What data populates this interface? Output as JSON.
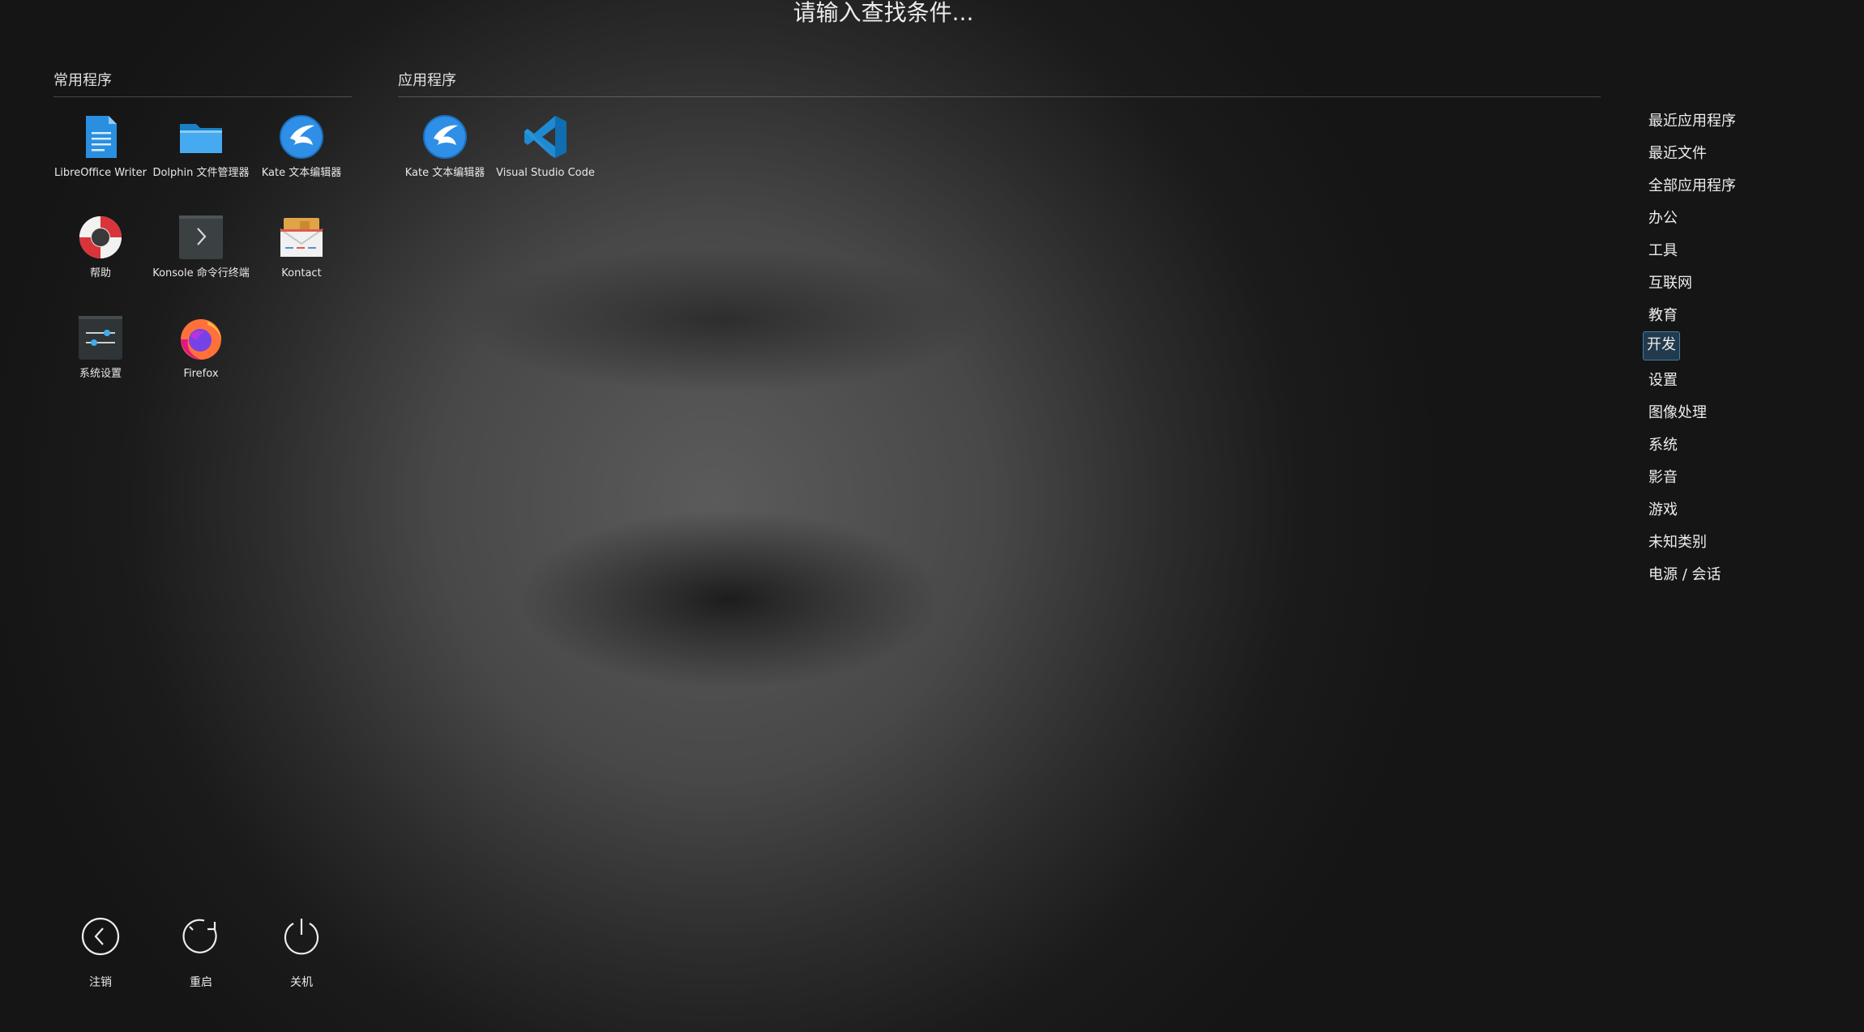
{
  "search": {
    "placeholder": "请输入查找条件..."
  },
  "favorites": {
    "title": "常用程序",
    "items": [
      {
        "label": "LibreOffice Writer",
        "icon": "libreoffice-writer-icon"
      },
      {
        "label": "Dolphin 文件管理器",
        "icon": "dolphin-folder-icon"
      },
      {
        "label": "Kate 文本编辑器",
        "icon": "kate-icon"
      },
      {
        "label": "帮助",
        "icon": "help-lifebuoy-icon"
      },
      {
        "label": "Konsole 命令行终端",
        "icon": "konsole-terminal-icon"
      },
      {
        "label": "Kontact",
        "icon": "kontact-mail-icon"
      },
      {
        "label": "系统设置",
        "icon": "system-settings-icon"
      },
      {
        "label": "Firefox",
        "icon": "firefox-icon"
      }
    ]
  },
  "applications": {
    "title": "应用程序",
    "items": [
      {
        "label": "Kate 文本编辑器",
        "icon": "kate-icon"
      },
      {
        "label": "Visual Studio Code",
        "icon": "vscode-icon"
      }
    ]
  },
  "categories": {
    "selected": "开发",
    "items": [
      "最近应用程序",
      "最近文件",
      "全部应用程序",
      "办公",
      "工具",
      "互联网",
      "教育",
      "开发",
      "设置",
      "图像处理",
      "系统",
      "影音",
      "游戏",
      "未知类别",
      "电源 / 会话"
    ]
  },
  "power": {
    "items": [
      {
        "label": "注销",
        "icon": "logout-icon"
      },
      {
        "label": "重启",
        "icon": "restart-icon"
      },
      {
        "label": "关机",
        "icon": "shutdown-icon"
      }
    ]
  },
  "colors": {
    "accent": "#3d7fae",
    "text": "#e6e6e6"
  }
}
